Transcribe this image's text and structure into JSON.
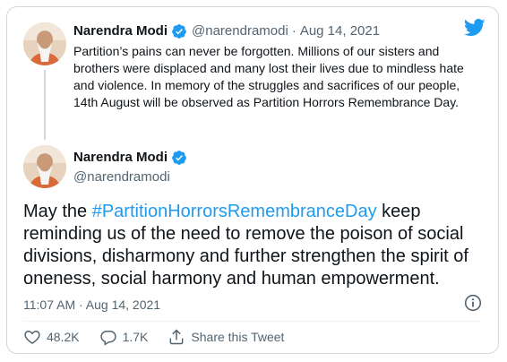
{
  "quoted_tweet": {
    "author_name": "Narendra Modi",
    "handle": "@narendramodi",
    "separator": "·",
    "date": "Aug 14, 2021",
    "text": "Partition’s pains can never be forgotten. Millions of our sisters and brothers were displaced and many lost their lives due to mindless hate and violence. In memory of the struggles and sacrifices of our people, 14th August will be observed as Partition Horrors Remembrance Day."
  },
  "tweet": {
    "author_name": "Narendra Modi",
    "handle": "@narendramodi",
    "text_before": "May the ",
    "hashtag": "#PartitionHorrorsRemembranceDay",
    "text_after": " keep reminding us of the need to remove the poison of social divisions, disharmony and further strengthen the spirit of oneness, social harmony and human empowerment.",
    "timestamp": "11:07 AM · Aug 14, 2021"
  },
  "actions": {
    "likes": "48.2K",
    "replies": "1.7K",
    "share_label": "Share this Tweet"
  },
  "icons": {
    "brand": "twitter-bird-icon",
    "verified": "verified-badge-icon",
    "info": "info-icon",
    "like": "heart-icon",
    "reply": "reply-bubble-icon",
    "share": "share-icon"
  },
  "colors": {
    "accent": "#1d9bf0",
    "text": "#0f1419",
    "muted": "#536471",
    "border": "#cfd9de"
  }
}
